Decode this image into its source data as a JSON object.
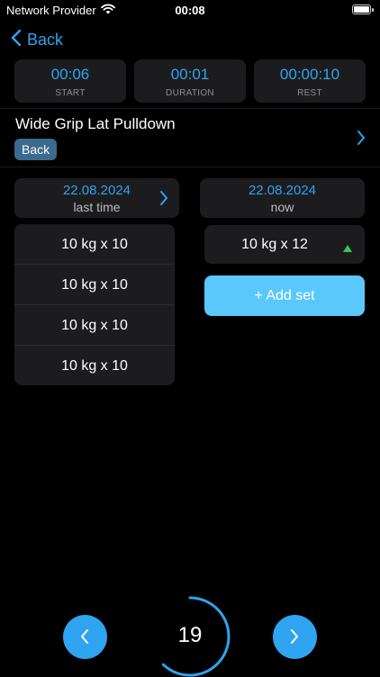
{
  "status_bar": {
    "carrier": "Network Provider",
    "time": "00:08"
  },
  "nav": {
    "back_label": "Back"
  },
  "stats": [
    {
      "value": "00:06",
      "label": "START"
    },
    {
      "value": "00:01",
      "label": "DURATION"
    },
    {
      "value": "00:00:10",
      "label": "REST"
    }
  ],
  "exercise": {
    "title": "Wide Grip Lat Pulldown",
    "tag": "Back"
  },
  "last_session": {
    "date": "22.08.2024",
    "caption": "last time",
    "sets": [
      "10 kg x 10",
      "10 kg x 10",
      "10 kg x 10",
      "10 kg x 10"
    ]
  },
  "current_session": {
    "date": "22.08.2024",
    "caption": "now",
    "sets": [
      "10 kg x 12"
    ],
    "add_set_label": "+ Add set"
  },
  "counter": {
    "value": "19",
    "progress": 0.62
  },
  "colors": {
    "accent": "#2fa4f0",
    "card": "#1c1c1e",
    "tag": "#3a6a8e",
    "add_button": "#5ac8fa",
    "trend_up": "#34c759"
  },
  "icons": {
    "wifi": "wifi-icon",
    "battery": "battery-icon",
    "back": "chevron-left-icon",
    "forward": "chevron-right-icon",
    "trend": "triangle-up-icon"
  }
}
